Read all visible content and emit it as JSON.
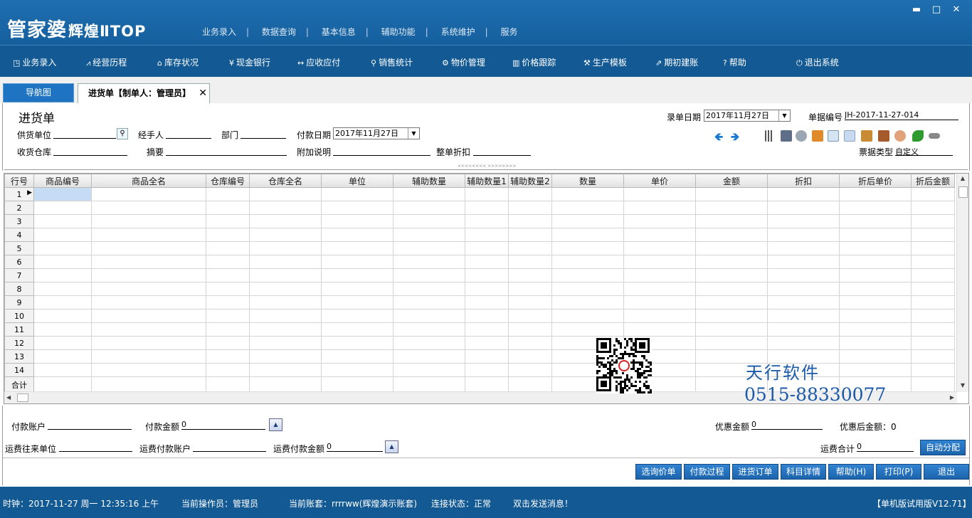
{
  "app": {
    "logo_main": "管家婆",
    "logo_sub": "辉煌ⅡTOP"
  },
  "window_controls": {
    "minimize": "▬",
    "maximize": "□",
    "close": "✕"
  },
  "top_menu": [
    "业务录入",
    "数据查询",
    "基本信息",
    "辅助功能",
    "系统维护",
    "服务"
  ],
  "toolbar": [
    {
      "icon": "◳",
      "label": "业务录入"
    },
    {
      "icon": "⩘",
      "label": "经营历程"
    },
    {
      "icon": "⌂",
      "label": "库存状况"
    },
    {
      "icon": "¥",
      "label": "现金银行"
    },
    {
      "icon": "↔",
      "label": "应收应付"
    },
    {
      "icon": "⚲",
      "label": "销售统计"
    },
    {
      "icon": "⚙",
      "label": "物价管理"
    },
    {
      "icon": "▥",
      "label": "价格跟踪"
    },
    {
      "icon": "⚒",
      "label": "生产模板"
    },
    {
      "icon": "⇗",
      "label": "期初建账"
    },
    {
      "icon": "?",
      "label": "帮助"
    },
    {
      "icon": "⏻",
      "label": "退出系统"
    }
  ],
  "tabs": {
    "nav": "导航图",
    "doc": "进货单【制单人：管理员】",
    "close": "✕"
  },
  "form": {
    "title": "进货单",
    "entry_date_label": "录单日期",
    "entry_date_value": "2017年11月27日",
    "doc_no_label": "单据编号",
    "doc_no_value": "JH-2017-11-27-014",
    "supplier_label": "供货单位",
    "handler_label": "经手人",
    "dept_label": "部门",
    "pay_date_label": "付款日期",
    "pay_date_value": "2017年11月27日",
    "warehouse_label": "收货仓库",
    "summary_label": "摘要",
    "note_label": "附加说明",
    "discount_label": "整单折扣",
    "ticket_type_label": "票据类型",
    "ticket_type_value": "自定义",
    "splitter": "<<<<<<<<   >>>>>>>>"
  },
  "grid": {
    "columns": [
      "行号",
      "商品编号",
      "商品全名",
      "仓库编号",
      "仓库全名",
      "单位",
      "辅助数量",
      "辅助数量1",
      "辅助数量2",
      "数量",
      "单价",
      "金额",
      "折扣",
      "折后单价",
      "折后金额"
    ],
    "rows": [
      "1",
      "2",
      "3",
      "4",
      "5",
      "6",
      "7",
      "8",
      "9",
      "10",
      "11",
      "12",
      "13",
      "14"
    ],
    "total_label": "合计",
    "current_row_marker": "▶"
  },
  "watermark": {
    "line1": "天行软件",
    "line2": "0515-88330077"
  },
  "bottom": {
    "pay_account_label": "付款账户",
    "pay_amount_label": "付款金额",
    "pay_amount_value": "0",
    "discount_amount_label": "优惠金额",
    "discount_amount_value": "0",
    "after_discount_label": "优惠后金额：",
    "after_discount_value": "0",
    "freight_unit_label": "运费往来单位",
    "freight_account_label": "运费付款账户",
    "freight_amount_label": "运费付款金额",
    "freight_amount_value": "0",
    "freight_total_label": "运费合计",
    "freight_total_value": "0",
    "auto_assign": "自动分配",
    "up_arrow": "▲"
  },
  "actions": [
    "选询价单",
    "付款过程",
    "进货订单",
    "科目详情",
    "帮助(H)",
    "打印(P)",
    "退出"
  ],
  "status": {
    "clock": "时钟：2017-11-27 周一 12:35:16 上午",
    "operator": "当前操作员：管理员",
    "account": "当前账套：rrrrww(辉煌演示账套)",
    "connection": "连接状态：正常",
    "message": "双击发送消息！",
    "version": "【单机版试用版V12.71】"
  },
  "colors": {
    "title_bg": "#1f6fb0",
    "toolbar_bg": "#135a95",
    "accent": "#1e74c2"
  }
}
